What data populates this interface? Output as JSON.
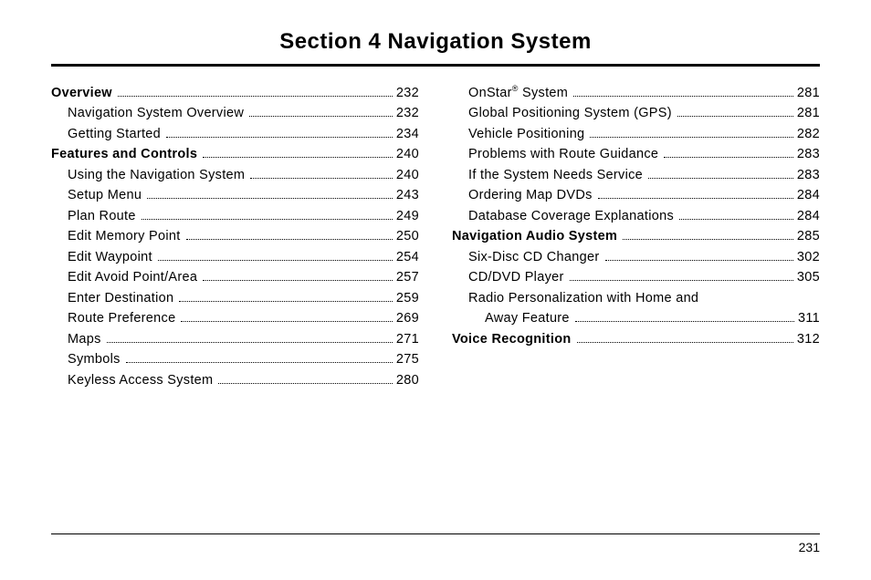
{
  "title": "Section  4     Navigation System",
  "page_number": "231",
  "left_column": [
    {
      "label": "Overview",
      "page": "232",
      "cls": "heading"
    },
    {
      "label": "Navigation System Overview",
      "page": "232",
      "cls": "sub"
    },
    {
      "label": "Getting Started",
      "page": "234",
      "cls": "sub"
    },
    {
      "label": "Features and Controls",
      "page": "240",
      "cls": "heading"
    },
    {
      "label": "Using the Navigation System",
      "page": "240",
      "cls": "sub"
    },
    {
      "label": "Setup Menu",
      "page": "243",
      "cls": "sub"
    },
    {
      "label": "Plan Route",
      "page": "249",
      "cls": "sub"
    },
    {
      "label": "Edit Memory Point",
      "page": "250",
      "cls": "sub"
    },
    {
      "label": "Edit Waypoint",
      "page": "254",
      "cls": "sub"
    },
    {
      "label": "Edit Avoid Point/Area",
      "page": "257",
      "cls": "sub"
    },
    {
      "label": "Enter Destination",
      "page": "259",
      "cls": "sub"
    },
    {
      "label": "Route Preference",
      "page": "269",
      "cls": "sub"
    },
    {
      "label": "Maps",
      "page": "271",
      "cls": "sub"
    },
    {
      "label": "Symbols",
      "page": "275",
      "cls": "sub"
    },
    {
      "label": "Keyless Access System",
      "page": "280",
      "cls": "sub"
    }
  ],
  "right_column": [
    {
      "label": "OnStar",
      "sup": "®",
      "suffix": " System",
      "page": "281",
      "cls": "sub"
    },
    {
      "label": "Global Positioning System (GPS)",
      "page": "281",
      "cls": "sub"
    },
    {
      "label": "Vehicle Positioning",
      "page": "282",
      "cls": "sub"
    },
    {
      "label": "Problems with Route Guidance",
      "page": "283",
      "cls": "sub"
    },
    {
      "label": "If the System Needs Service",
      "page": "283",
      "cls": "sub"
    },
    {
      "label": "Ordering Map DVDs",
      "page": "284",
      "cls": "sub"
    },
    {
      "label": "Database Coverage Explanations",
      "page": "284",
      "cls": "sub"
    },
    {
      "label": "Navigation Audio System",
      "page": "285",
      "cls": "heading"
    },
    {
      "label": "Six-Disc CD Changer",
      "page": "302",
      "cls": "sub"
    },
    {
      "label": "CD/DVD Player",
      "page": "305",
      "cls": "sub"
    },
    {
      "label": "Radio Personalization with Home and",
      "cls": "sub",
      "nobreak": true
    },
    {
      "label": "Away Feature",
      "page": "311",
      "cls": "sub2"
    },
    {
      "label": "Voice Recognition",
      "page": "312",
      "cls": "heading"
    }
  ]
}
